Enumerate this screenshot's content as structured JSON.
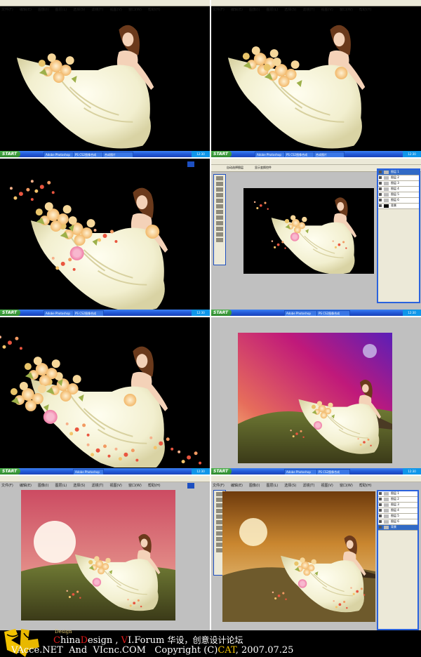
{
  "photoshop": {
    "menu_items": [
      "文件(F)",
      "编辑(E)",
      "图像(I)",
      "图层(L)",
      "选择(S)",
      "滤镜(T)",
      "视图(V)",
      "窗口(W)",
      "帮助(H)"
    ],
    "taskbar": {
      "start_label": "START",
      "buttons": [
        "Adobe Photoshop",
        "PS CS2图像合成",
        "合成图片"
      ],
      "clock": "12:30"
    },
    "layers_panel": {
      "rows": [
        "图层 1",
        "图层 2",
        "图层 3",
        "图层 4",
        "图层 5",
        "图层 6",
        "背景"
      ]
    },
    "option_bar_labels": [
      "自动选择图层",
      "显示变换控件"
    ]
  },
  "footer": {
    "logo_word": "Design",
    "line1": {
      "china_c": "C",
      "china_rest": "hina",
      "design_d": "D",
      "design_rest": "esign ,",
      "vi_v": "V",
      "vi_rest": "I.Forum",
      "cn_text": "华设，创意设计论坛"
    },
    "line2": {
      "vacce": "VAcce.NET",
      "and": "And",
      "vicnc": "VIcnc.COM",
      "copyright_text": "Copyright (C)",
      "cat": "CAT",
      "date": ", 2007.07.25"
    }
  },
  "colors": {
    "xp_blue": "#225ad8",
    "footer_red": "#e21a1a",
    "footer_gold": "#f0c000"
  }
}
